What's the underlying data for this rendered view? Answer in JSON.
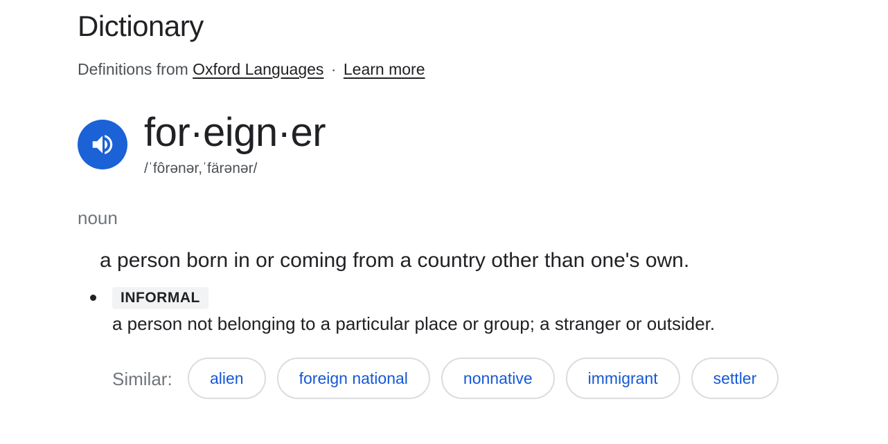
{
  "header": {
    "title": "Dictionary",
    "source_prefix": "Definitions from",
    "source_link": "Oxford Languages",
    "separator": "·",
    "learn_more": "Learn more"
  },
  "entry": {
    "audio_icon": "speaker-icon",
    "headword": "for·eign·er",
    "pronunciation": "/ˈfôrənər,ˈfärənər/",
    "part_of_speech": "noun",
    "definition_1": "a person born in or coming from a country other than one's own.",
    "sense_2": {
      "label": "INFORMAL",
      "definition": "a person not belonging to a particular place or group; a stranger or outsider."
    }
  },
  "similar": {
    "label": "Similar:",
    "words": [
      "alien",
      "foreign national",
      "nonnative",
      "immigrant",
      "settler"
    ]
  },
  "colors": {
    "audio_button": "#1a62d6",
    "chip_text": "#1558d6",
    "chip_border": "#dadce0"
  }
}
